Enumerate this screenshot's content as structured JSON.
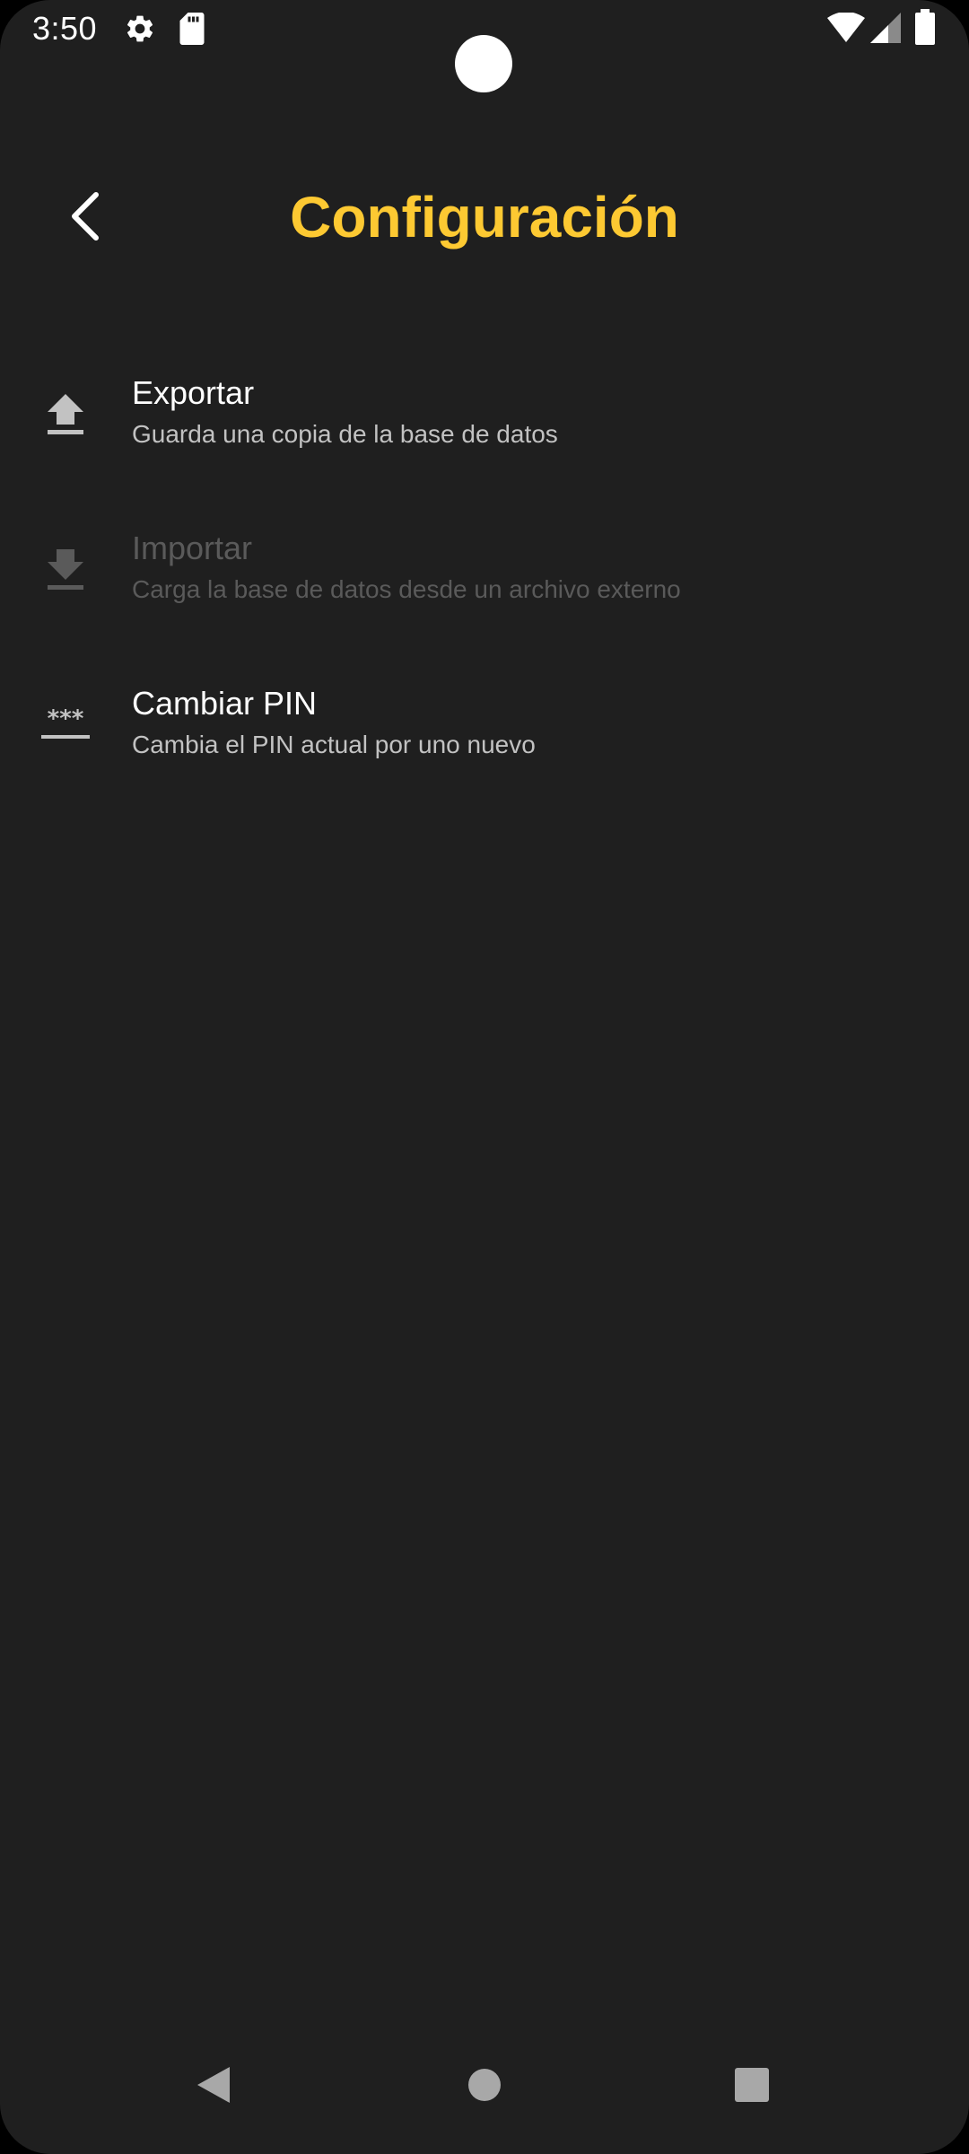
{
  "status_bar": {
    "time": "3:50",
    "icons": [
      "settings-gear-icon",
      "sd-card-icon",
      "wifi-icon",
      "cell-signal-icon",
      "battery-icon"
    ]
  },
  "toolbar": {
    "title": "Configuración",
    "back_icon": "chevron-left-icon"
  },
  "settings": {
    "items": [
      {
        "title": "Exportar",
        "subtitle": "Guarda una copia de la base de datos",
        "icon": "upload-icon",
        "enabled": true
      },
      {
        "title": "Importar",
        "subtitle": "Carga la base de datos desde un archivo externo",
        "icon": "download-icon",
        "enabled": false
      },
      {
        "title": "Cambiar PIN",
        "subtitle": "Cambia el PIN actual por uno nuevo",
        "icon": "password-icon",
        "enabled": true
      }
    ]
  },
  "nav_bar": {
    "buttons": [
      "back-triangle-icon",
      "home-circle-icon",
      "recents-square-icon"
    ]
  },
  "colors": {
    "background": "#1f1f1f",
    "accent_title": "#fdc932",
    "text_primary": "#ffffff",
    "text_secondary": "#c2c2c2",
    "text_disabled": "#5a5a5a"
  }
}
